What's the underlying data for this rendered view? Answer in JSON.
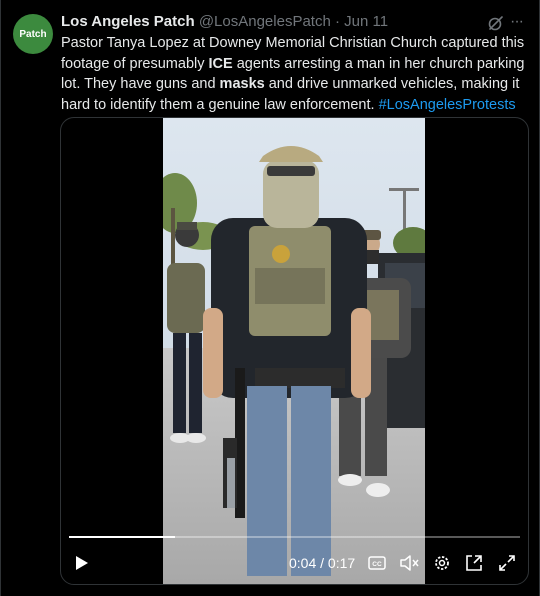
{
  "tweet": {
    "avatar_text": "Patch",
    "author_name": "Los Angeles Patch",
    "handle": "@LosAngelesPatch",
    "separator": "·",
    "date": "Jun 11",
    "more_label": "···",
    "text": {
      "p1": "Pastor Tanya Lopez at Downey Memorial Christian Church captured this footage of presumably ",
      "b1": "ICE",
      "p2": " agents arresting a man in her church parking lot. They have guns and ",
      "b2": "masks",
      "p3": " and drive unmarked vehicles, making it hard to identify them a genuine law enforcement. ",
      "hashtag": "#LosAngelesProtests"
    }
  },
  "video": {
    "time_display": "0:04 / 0:17",
    "progress": 0.235,
    "controls": [
      "play-icon",
      "captions-icon",
      "mute-icon",
      "settings-icon",
      "pip-icon",
      "fullscreen-icon"
    ]
  },
  "colors": {
    "background": "#000000",
    "text": "#e7e9ea",
    "muted": "#71767b",
    "link": "#1d9bf0",
    "avatar": "#3c8a3e"
  }
}
